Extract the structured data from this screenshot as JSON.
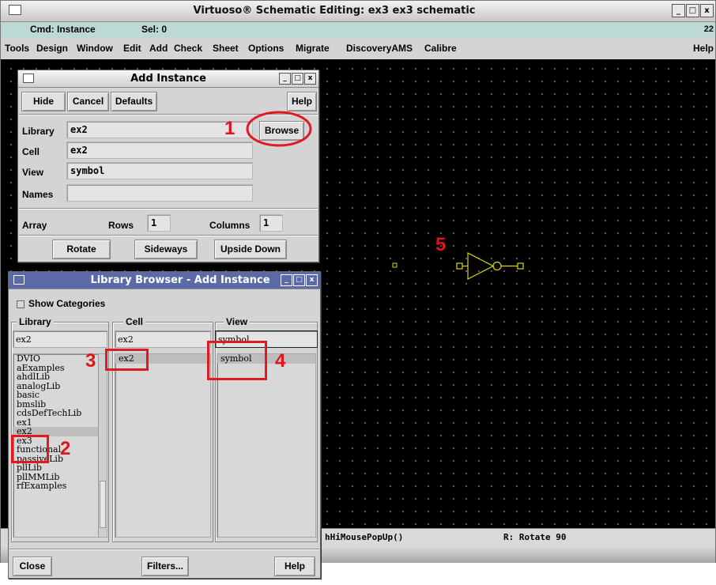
{
  "main_window": {
    "title": "Virtuoso® Schematic Editing: ex3 ex3 schematic",
    "cmd_label": "Cmd: Instance",
    "sel_label": "Sel: 0",
    "cmd_right": "22",
    "menu": [
      "Tools",
      "Design",
      "Window",
      "Edit",
      "Add",
      "Check",
      "Sheet",
      "Options",
      "Migrate",
      "DiscoveryAMS",
      "Calibre"
    ],
    "help": "Help",
    "status_left": "hHiMousePopUp()",
    "status_right": "R: Rotate 90"
  },
  "add_instance": {
    "title": "Add Instance",
    "buttons": {
      "hide": "Hide",
      "cancel": "Cancel",
      "defaults": "Defaults",
      "help": "Help",
      "browse": "Browse"
    },
    "fields": {
      "library_label": "Library",
      "library_value": "ex2",
      "cell_label": "Cell",
      "cell_value": "ex2",
      "view_label": "View",
      "view_value": "symbol",
      "names_label": "Names",
      "names_value": ""
    },
    "array": {
      "label": "Array",
      "rows_label": "Rows",
      "rows_value": "1",
      "columns_label": "Columns",
      "columns_value": "1"
    },
    "transform_buttons": {
      "rotate": "Rotate",
      "sideways": "Sideways",
      "upside_down": "Upside Down"
    }
  },
  "library_browser": {
    "title": "Library Browser - Add Instance",
    "show_categories": "Show Categories",
    "columns": {
      "library": "Library",
      "cell": "Cell",
      "view": "View"
    },
    "filters": {
      "library": "ex2",
      "cell": "ex2",
      "view": "symbol"
    },
    "libraries": [
      "DVIO",
      "aExamples",
      "ahdlLib",
      "analogLib",
      "basic",
      "bmslib",
      "cdsDefTechLib",
      "ex1",
      "ex2",
      "ex3",
      "functional",
      "passiveLib",
      "pllLib",
      "pllMMLib",
      "rfExamples"
    ],
    "selected_library": "ex2",
    "cells": [
      "ex2"
    ],
    "views": [
      "symbol"
    ],
    "buttons": {
      "close": "Close",
      "filters": "Filters...",
      "help": "Help"
    }
  },
  "annotations": [
    "1",
    "2",
    "3",
    "4",
    "5"
  ],
  "colors": {
    "annotation": "#e01a20",
    "symbol": "#d8d800",
    "canvas": "#000000",
    "browser_title": "#5c6ba8",
    "cmd_bar": "#bcd9d5"
  }
}
